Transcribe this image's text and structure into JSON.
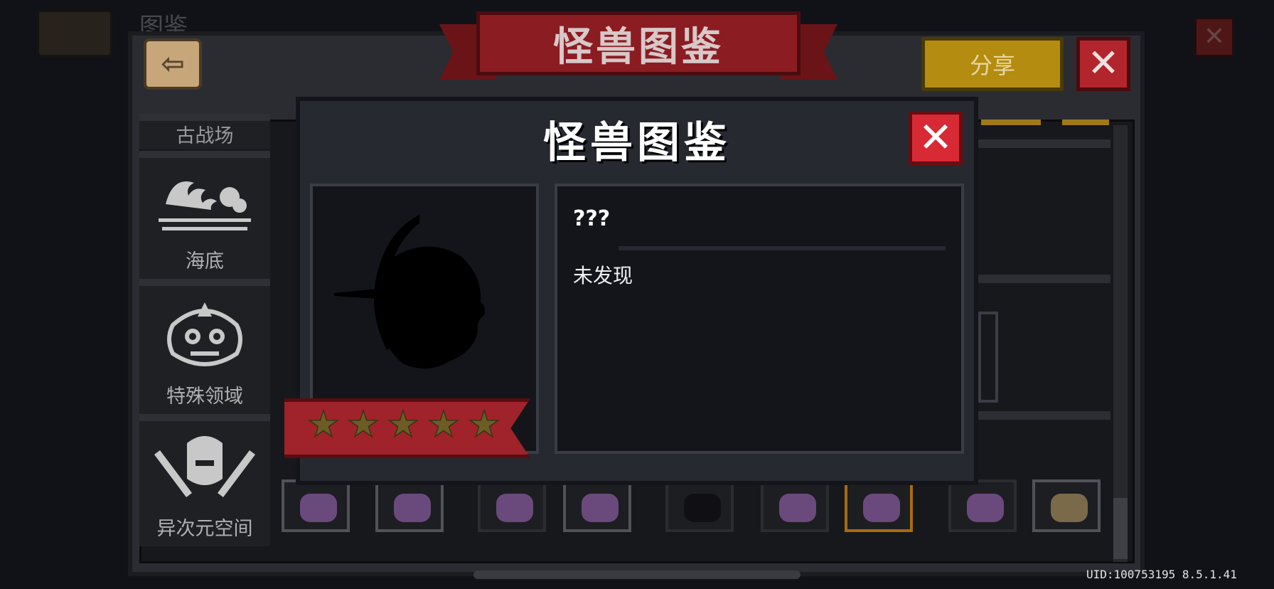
{
  "background": {
    "title_partial": "图鉴"
  },
  "header": {
    "banner_title": "怪兽图鉴",
    "share_label": "分享",
    "close_glyph": "✕",
    "back_glyph": "⇦"
  },
  "sidebar": {
    "items": [
      {
        "label": "古战场",
        "icon": "ancient-battlefield-icon"
      },
      {
        "label": "海底",
        "icon": "waves-icon"
      },
      {
        "label": "特殊领域",
        "icon": "lion-mask-icon"
      },
      {
        "label": "异次元空间",
        "icon": "knight-helmet-swords-icon"
      }
    ]
  },
  "modal": {
    "title": "怪兽图鉴",
    "close_glyph": "✕",
    "monster_name": "???",
    "status": "未发现",
    "stars": 5,
    "portrait": "unknown-monster-silhouette"
  },
  "footer": {
    "uid": "UID:100753195 8.5.1.41"
  },
  "colors": {
    "accent_red": "#d72a35",
    "share_gold": "#b38c10",
    "panel": "#262930"
  }
}
